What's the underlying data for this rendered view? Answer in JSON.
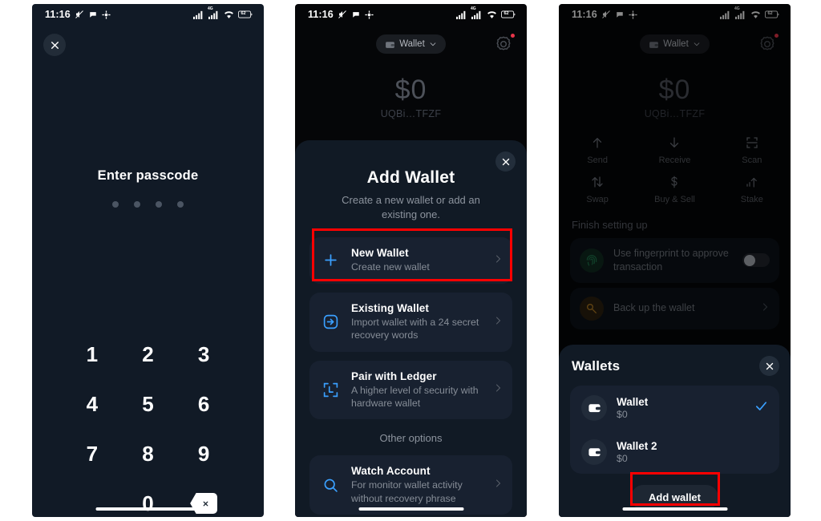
{
  "screens": {
    "passcode": {
      "status": {
        "time": "11:16",
        "battery": "62",
        "network": "4G"
      },
      "close_icon": "close-icon",
      "title": "Enter passcode",
      "dots_count": 4,
      "keys": [
        "1",
        "2",
        "3",
        "4",
        "5",
        "6",
        "7",
        "8",
        "9",
        "",
        "0",
        "backspace"
      ]
    },
    "add_wallet": {
      "status": {
        "time": "11:16",
        "battery": "62",
        "network": "4G"
      },
      "header": {
        "wallet_pill_label": "Wallet",
        "wallet_icon": "wallet-icon",
        "chevron_icon": "chevron-down-icon",
        "settings_icon": "gear-icon",
        "badge_color": "#e8354a"
      },
      "balance": {
        "amount": "$0",
        "address": "UQBi…TFZF"
      },
      "sheet": {
        "title": "Add Wallet",
        "subtitle": "Create a new wallet or add an existing one.",
        "close_icon": "close-icon",
        "options": [
          {
            "icon": "plus-icon",
            "title": "New Wallet",
            "desc": "Create new wallet",
            "highlighted": true
          },
          {
            "icon": "import-icon",
            "title": "Existing Wallet",
            "desc": "Import wallet with a 24 secret recovery words",
            "highlighted": false
          },
          {
            "icon": "ledger-icon",
            "title": "Pair with Ledger",
            "desc": "A higher level of security with hardware wallet",
            "highlighted": false
          }
        ],
        "other_options_label": "Other options",
        "watch": {
          "icon": "search-icon",
          "title": "Watch Account",
          "desc": "For monitor wallet activity without recovery phrase"
        }
      }
    },
    "wallets": {
      "status": {
        "time": "11:16",
        "battery": "62",
        "network": "4G"
      },
      "header": {
        "wallet_pill_label": "Wallet",
        "wallet_icon": "wallet-icon",
        "chevron_icon": "chevron-down-icon",
        "settings_icon": "gear-icon",
        "badge_color": "#e8354a"
      },
      "balance": {
        "amount": "$0",
        "address": "UQBi…TFZF"
      },
      "actions": [
        {
          "icon": "arrow-up-icon",
          "label": "Send"
        },
        {
          "icon": "arrow-down-icon",
          "label": "Receive"
        },
        {
          "icon": "scan-icon",
          "label": "Scan"
        },
        {
          "icon": "swap-icon",
          "label": "Swap"
        },
        {
          "icon": "dollar-icon",
          "label": "Buy & Sell"
        },
        {
          "icon": "stake-icon",
          "label": "Stake"
        }
      ],
      "finish_setting_up": {
        "title": "Finish setting up",
        "items": [
          {
            "icon": "fingerprint-icon",
            "text": "Use fingerprint to approve transaction",
            "control": "toggle",
            "toggle_on": false
          },
          {
            "icon": "key-icon",
            "text": "Back up the wallet",
            "control": "chevron"
          }
        ]
      },
      "sheet": {
        "title": "Wallets",
        "close_icon": "close-icon",
        "rows": [
          {
            "icon": "wallet-icon",
            "name": "Wallet",
            "balance": "$0",
            "selected": true
          },
          {
            "icon": "wallet-icon",
            "name": "Wallet 2",
            "balance": "$0",
            "selected": false
          }
        ],
        "add_button_label": "Add wallet",
        "add_button_highlighted": true
      }
    }
  },
  "colors": {
    "accent_blue": "#3aa0ff",
    "highlight_red": "#ff0000",
    "sheet_bg": "#111a25",
    "card_bg": "#182130"
  }
}
